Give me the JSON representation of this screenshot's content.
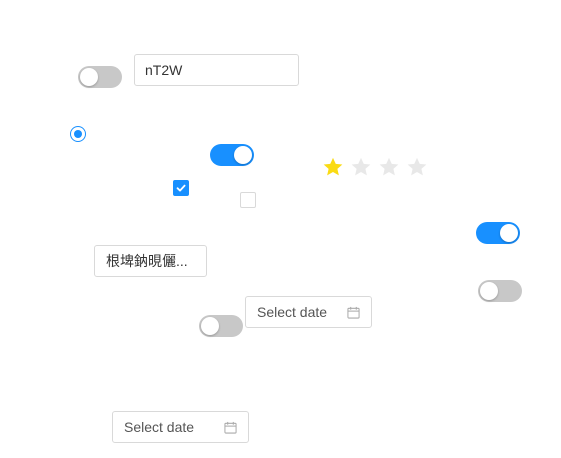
{
  "text_input": {
    "value": "nT2W"
  },
  "select": {
    "value": "根埤鈉晛儷..."
  },
  "date_pickers": [
    {
      "placeholder": "Select date"
    },
    {
      "placeholder": "Select date"
    }
  ],
  "toggles": [
    {
      "checked": false
    },
    {
      "checked": true
    },
    {
      "checked": true
    },
    {
      "checked": false
    },
    {
      "checked": false
    }
  ],
  "radio": {
    "checked": true
  },
  "checkboxes": [
    {
      "checked": true
    },
    {
      "checked": false
    }
  ],
  "rating": {
    "value": 1,
    "max": 4
  },
  "colors": {
    "accent": "#1890ff",
    "switch_off": "#c8c8c8",
    "star_on": "#fadb14",
    "star_off": "#e8e8e8",
    "border": "#d9d9d9"
  },
  "icons": {
    "calendar": "calendar-icon",
    "check": "check-icon",
    "star": "star-icon"
  }
}
